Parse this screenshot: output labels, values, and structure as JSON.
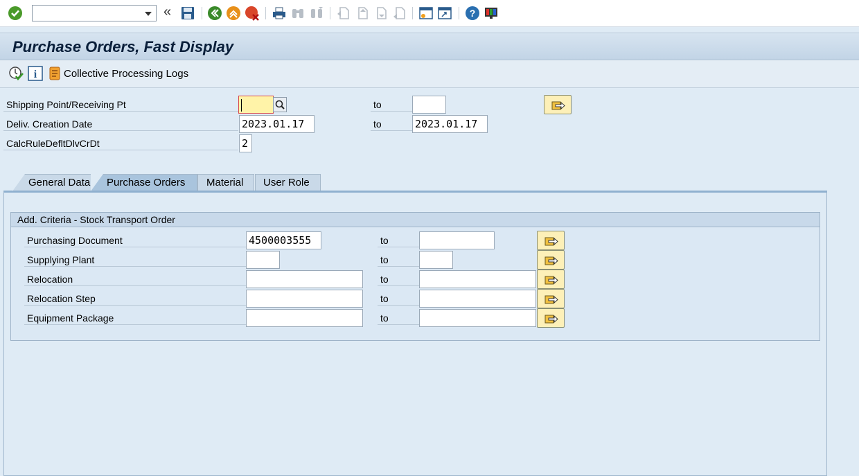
{
  "toolbar": {
    "command_field_value": "",
    "icons": [
      "enter-icon",
      "expand-icon",
      "save-icon",
      "back-icon",
      "exit-icon",
      "cancel-icon",
      "print-icon",
      "find-icon",
      "find-next-icon",
      "first-page-icon",
      "previous-page-icon",
      "next-page-icon",
      "last-page-icon",
      "create-session-icon",
      "shortcut-icon",
      "help-icon",
      "customize-layout-icon"
    ]
  },
  "title": "Purchase Orders, Fast Display",
  "app_toolbar": {
    "icons": [
      "execute-icon",
      "info-icon",
      "logs-icon"
    ],
    "logs_label": "Collective Processing Logs"
  },
  "selection": {
    "to_label": "to",
    "shipping_point": {
      "label": "Shipping Point/Receiving Pt",
      "from": "",
      "to": ""
    },
    "delivery_date": {
      "label": "Deliv. Creation Date",
      "from": "2023.01.17",
      "to": "2023.01.17"
    },
    "calc_rule": {
      "label": "CalcRuleDefltDlvCrDt",
      "value": "2"
    }
  },
  "tabs": [
    {
      "label": "General Data",
      "active": false
    },
    {
      "label": "Purchase Orders",
      "active": true
    },
    {
      "label": "Material",
      "active": false
    },
    {
      "label": "User Role",
      "active": false
    }
  ],
  "group": {
    "title": "Add. Criteria - Stock Transport Order",
    "rows": [
      {
        "label": "Purchasing Document",
        "from": "4500003555",
        "to": ""
      },
      {
        "label": "Supplying Plant",
        "from": "",
        "to": ""
      },
      {
        "label": "Relocation",
        "from": "",
        "to": ""
      },
      {
        "label": "Relocation Step",
        "from": "",
        "to": ""
      },
      {
        "label": "Equipment Package",
        "from": "",
        "to": ""
      }
    ]
  },
  "colors": {
    "background": "#dfebf5",
    "title_bar": "#c2d4e6",
    "required_field": "#fff3a8",
    "multi_select_button": "#fdf0b8"
  }
}
